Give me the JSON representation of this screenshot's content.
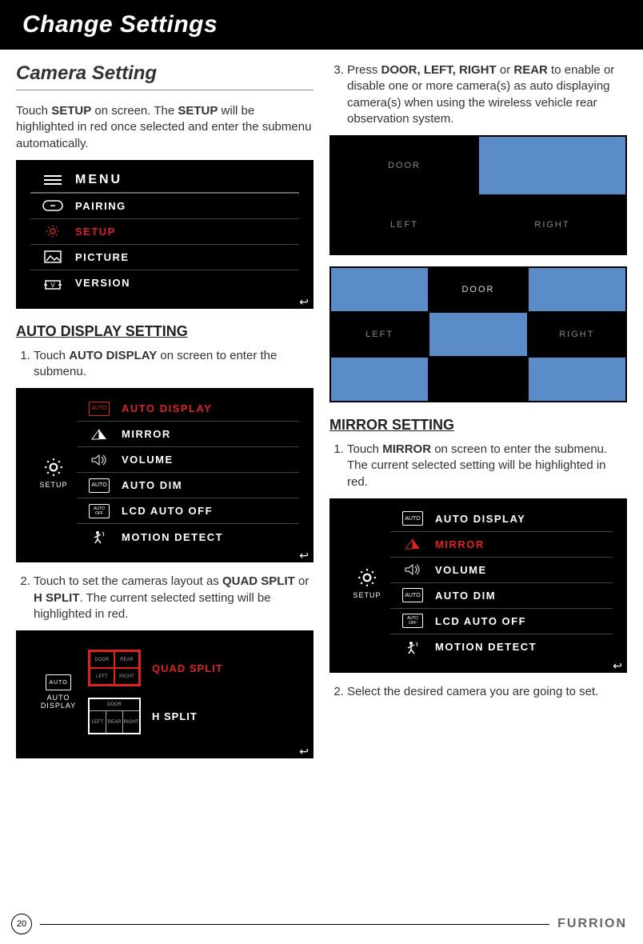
{
  "banner": "Change Settings",
  "left": {
    "section_title": "Camera Setting",
    "intro_a": "Touch ",
    "intro_b": "SETUP",
    "intro_c": " on screen. The ",
    "intro_d": "SETUP",
    "intro_e": " will be highlighted in red once selected and enter the submenu automatically.",
    "menu_header": "MENU",
    "menu_items": [
      "PAIRING",
      "SETUP",
      "PICTURE",
      "VERSION"
    ],
    "auto_title": "AUTO DISPLAY SETTING",
    "step1_a": "Touch ",
    "step1_b": "AUTO DISPLAY",
    "step1_c": " on screen to enter the submenu.",
    "setup_side": "SETUP",
    "setup_items": [
      "AUTO DISPLAY",
      "MIRROR",
      "VOLUME",
      "AUTO DIM",
      "LCD AUTO OFF",
      "MOTION DETECT"
    ],
    "step2_a": "Touch to set the cameras layout as ",
    "step2_b": "QUAD SPLIT",
    "step2_c": " or ",
    "step2_d": "H SPLIT",
    "step2_e": ". The current selected setting will be highlighted in red.",
    "auto_side": "AUTO DISPLAY",
    "quad_label": "QUAD SPLIT",
    "hsplit_label": "H SPLIT",
    "quad_cells": [
      "DOOR",
      "REAR",
      "LEFT",
      "RIGHT"
    ],
    "h_cells": {
      "top": "DOOR",
      "left": "LEFT",
      "mid": "REAR",
      "right": "RIGHT"
    }
  },
  "right": {
    "step3_a": "Press ",
    "step3_b": "DOOR, LEFT, RIGHT",
    "step3_c": " or ",
    "step3_d": "REAR",
    "step3_e": " to enable or disable one or more camera(s) as auto displaying camera(s) when using the wireless vehicle rear observation system.",
    "grid1": {
      "door": "DOOR",
      "left": "LEFT",
      "right": "RIGHT"
    },
    "grid2": {
      "door": "DOOR",
      "left": "LEFT",
      "right": "RIGHT"
    },
    "mirror_title": "MIRROR SETTING",
    "m_step1_a": "Touch ",
    "m_step1_b": "MIRROR",
    "m_step1_c": " on screen to enter the submenu. The current selected setting will be highlighted in red.",
    "setup_side": "SETUP",
    "setup_items": [
      "AUTO DISPLAY",
      "MIRROR",
      "VOLUME",
      "AUTO DIM",
      "LCD AUTO OFF",
      "MOTION DETECT"
    ],
    "m_step2": "Select the desired camera you are going to set."
  },
  "page_num": "20",
  "brand": "FURRION"
}
